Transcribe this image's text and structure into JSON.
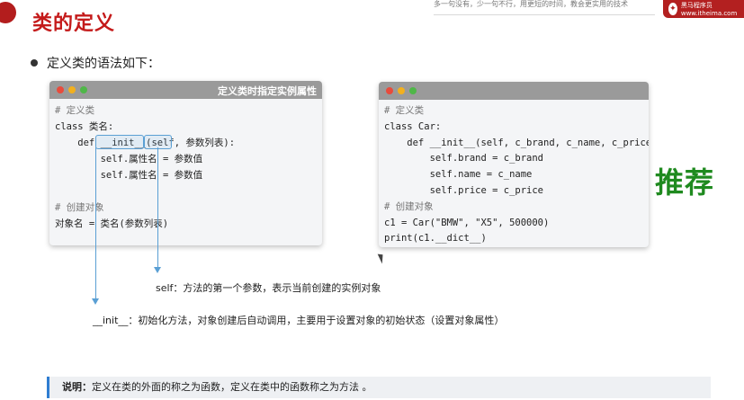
{
  "header": {
    "title": "类的定义",
    "top_strip_text": "多一句没有，少一句不行，用更短的时间，教会更实用的技术",
    "logo_text": "黑马程序员 www.itheima.com",
    "colors": {
      "title": "#c41a1a",
      "accent": "#b32020"
    }
  },
  "bullet": {
    "text": "定义类的语法如下："
  },
  "left_window": {
    "title": "定义类时指定实例属性",
    "lines": [
      "# 定义类",
      "class 类名:",
      "    def __init__(self, 参数列表):",
      "        self.属性名 = 参数值",
      "        self.属性名 = 参数值",
      "",
      "# 创建对象",
      "对象名 = 类名(参数列表)"
    ]
  },
  "right_window": {
    "lines": [
      "# 定义类",
      "class Car:",
      "    def __init__(self, c_brand, c_name, c_price):",
      "        self.brand = c_brand",
      "        self.name = c_name",
      "        self.price = c_price",
      "# 创建对象",
      "c1 = Car(\"BMW\", \"X5\", 500000)",
      "print(c1.__dict__)"
    ]
  },
  "recommend_label": "推荐",
  "annotations": {
    "self_note": "self：方法的第一个参数，表示当前创建的实例对象",
    "init_note": "__init__：初始化方法，对象创建后自动调用，主要用于设置对象的初始状态（设置对象属性）"
  },
  "note": {
    "label": "说明：",
    "text": "定义在类的外面的称之为函数，定义在类中的函数称之为方法 。"
  }
}
